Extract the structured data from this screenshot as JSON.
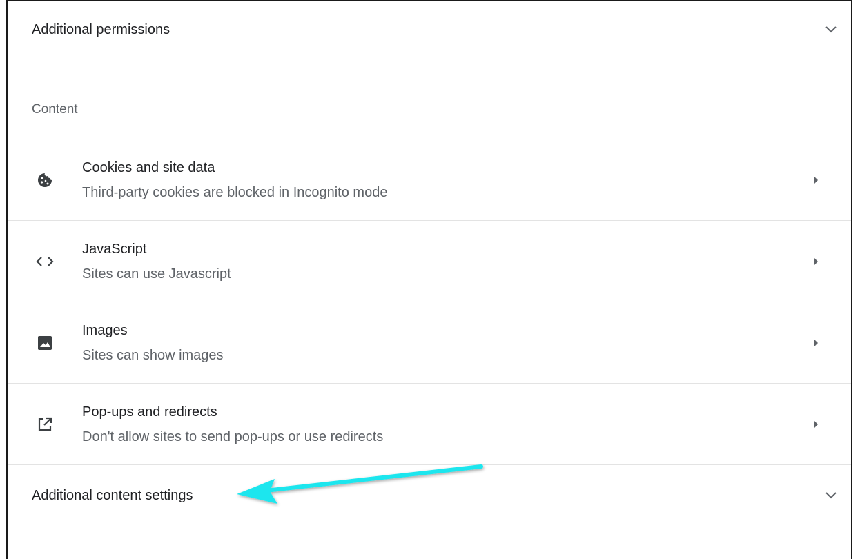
{
  "additional_permissions": {
    "label": "Additional permissions"
  },
  "content_section": {
    "title": "Content",
    "items": [
      {
        "icon": "cookie-icon",
        "title": "Cookies and site data",
        "subtitle": "Third-party cookies are blocked in Incognito mode"
      },
      {
        "icon": "code-icon",
        "title": "JavaScript",
        "subtitle": "Sites can use Javascript"
      },
      {
        "icon": "image-icon",
        "title": "Images",
        "subtitle": "Sites can show images"
      },
      {
        "icon": "open-in-new-icon",
        "title": "Pop-ups and redirects",
        "subtitle": "Don't allow sites to send pop-ups or use redirects"
      }
    ]
  },
  "additional_content": {
    "label": "Additional content settings"
  },
  "annotation": {
    "arrow_color": "#1ee6ee"
  }
}
